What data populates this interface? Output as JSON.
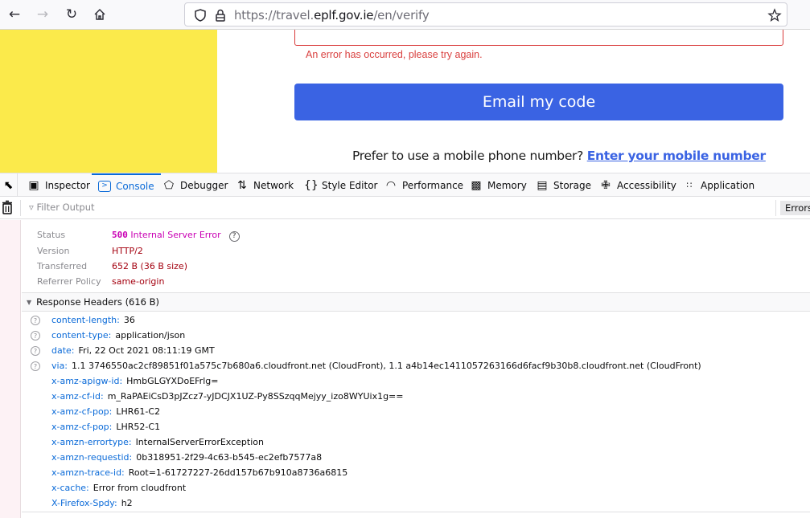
{
  "browser": {
    "url_prefix": "https://travel.",
    "url_domain": "eplf.gov.ie",
    "url_path": "/en/verify",
    "icons": {
      "back": "arrow-left-icon",
      "forward": "arrow-right-icon",
      "reload": "reload-icon",
      "home": "home-icon",
      "shield": "shield-icon",
      "lock": "lock-icon",
      "bookmark": "star-icon"
    }
  },
  "page": {
    "error_message": "An error has occurred, please try again.",
    "email_button": "Email my code",
    "mobile_prompt": "Prefer to use a mobile phone number?",
    "mobile_link": "Enter your mobile number",
    "colors": {
      "accent": "#3a63e3",
      "error": "#d9403f",
      "banner": "#fbea4b"
    }
  },
  "devtools": {
    "tabs": [
      {
        "label": "Inspector",
        "icon": "inspector-icon"
      },
      {
        "label": "Console",
        "icon": "console-icon",
        "active": true
      },
      {
        "label": "Debugger",
        "icon": "debugger-icon"
      },
      {
        "label": "Network",
        "icon": "network-icon"
      },
      {
        "label": "Style Editor",
        "icon": "style-editor-icon"
      },
      {
        "label": "Performance",
        "icon": "performance-icon"
      },
      {
        "label": "Memory",
        "icon": "memory-icon"
      },
      {
        "label": "Storage",
        "icon": "storage-icon"
      },
      {
        "label": "Accessibility",
        "icon": "accessibility-icon"
      },
      {
        "label": "Application",
        "icon": "application-icon"
      }
    ],
    "filter_placeholder": "Filter Output",
    "errors_button": "Errors",
    "summary": {
      "status_label": "Status",
      "status_code": "500",
      "status_text": "Internal Server Error",
      "version_label": "Version",
      "version": "HTTP/2",
      "transferred_label": "Transferred",
      "transferred": "652 B (36 B size)",
      "referrer_label": "Referrer Policy",
      "referrer": "same-origin"
    },
    "response_headers_title": "Response Headers (616 B)",
    "headers": [
      {
        "name": "content-length:",
        "value": "36",
        "help": true
      },
      {
        "name": "content-type:",
        "value": "application/json",
        "help": true
      },
      {
        "name": "date:",
        "value": "Fri, 22 Oct 2021 08:11:19 GMT",
        "help": true
      },
      {
        "name": "via:",
        "value": "1.1 3746550ac2cf89851f01a575c7b680a6.cloudfront.net (CloudFront), 1.1 a4b14ec1411057263166d6facf9b30b8.cloudfront.net (CloudFront)",
        "help": true
      },
      {
        "name": "x-amz-apigw-id:",
        "value": "HmbGLGYXDoEFrlg="
      },
      {
        "name": "x-amz-cf-id:",
        "value": "m_RaPAEiCsD3pJZcz7-yJDCJX1UZ-Py8SSzqqMejyy_izo8WYUix1g=="
      },
      {
        "name": "x-amz-cf-pop:",
        "value": "LHR61-C2"
      },
      {
        "name": "x-amz-cf-pop:",
        "value": "LHR52-C1"
      },
      {
        "name": "x-amzn-errortype:",
        "value": "InternalServerErrorException"
      },
      {
        "name": "x-amzn-requestid:",
        "value": "0b318951-2f29-4c63-b545-ec2efb7577a8"
      },
      {
        "name": "x-amzn-trace-id:",
        "value": "Root=1-61727227-26dd157b67b910a8736a6815"
      },
      {
        "name": "x-cache:",
        "value": "Error from cloudfront"
      },
      {
        "name": "X-Firefox-Spdy:",
        "value": "h2"
      }
    ]
  }
}
